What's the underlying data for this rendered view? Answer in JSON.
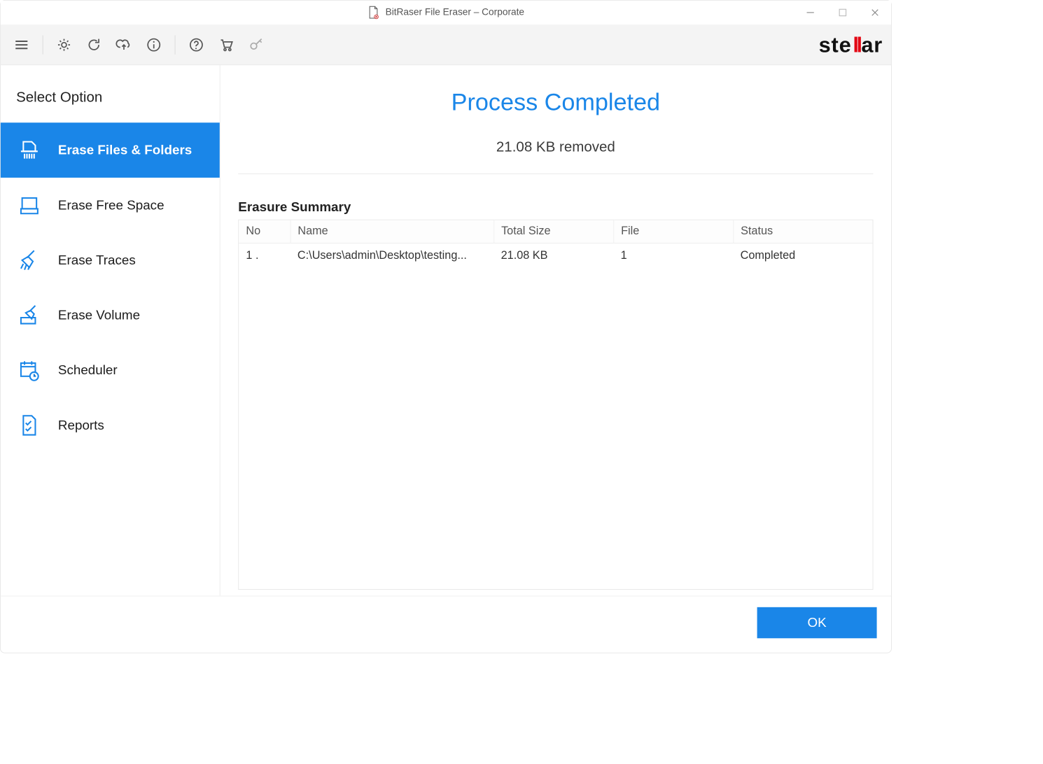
{
  "window": {
    "title": "BitRaser File Eraser – Corporate"
  },
  "brand": {
    "name": "stellar",
    "accent": "#e30613",
    "primary": "#1a86e8"
  },
  "toolbar": {
    "items": [
      "menu",
      "settings",
      "refresh",
      "upload",
      "info",
      "help",
      "cart",
      "key"
    ]
  },
  "sidebar": {
    "title": "Select Option",
    "items": [
      {
        "id": "erase-files-folders",
        "label": "Erase Files & Folders",
        "active": true
      },
      {
        "id": "erase-free-space",
        "label": "Erase Free Space",
        "active": false
      },
      {
        "id": "erase-traces",
        "label": "Erase Traces",
        "active": false
      },
      {
        "id": "erase-volume",
        "label": "Erase Volume",
        "active": false
      },
      {
        "id": "scheduler",
        "label": "Scheduler",
        "active": false
      },
      {
        "id": "reports",
        "label": "Reports",
        "active": false
      }
    ]
  },
  "main": {
    "title": "Process Completed",
    "subtitle": "21.08 KB removed",
    "summary_label": "Erasure Summary",
    "columns": {
      "no": "No",
      "name": "Name",
      "size": "Total Size",
      "file": "File",
      "status": "Status"
    },
    "rows": [
      {
        "no": "1 .",
        "name": "C:\\Users\\admin\\Desktop\\testing...",
        "size": "21.08 KB",
        "file": "1",
        "status": "Completed"
      }
    ]
  },
  "footer": {
    "ok_label": "OK"
  }
}
